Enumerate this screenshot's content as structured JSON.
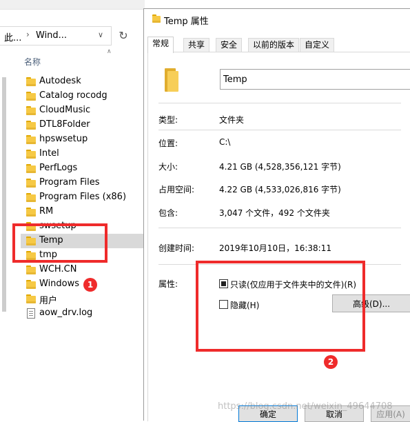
{
  "explorer": {
    "address_segments": [
      "此...",
      "Wind..."
    ],
    "column_header": "名称",
    "items": [
      {
        "name": "Autodesk",
        "type": "folder",
        "selected": false
      },
      {
        "name": "Catalog rocodg",
        "type": "folder",
        "selected": false
      },
      {
        "name": "CloudMusic",
        "type": "folder",
        "selected": false
      },
      {
        "name": "DTL8Folder",
        "type": "folder",
        "selected": false
      },
      {
        "name": "hpswsetup",
        "type": "folder",
        "selected": false
      },
      {
        "name": "Intel",
        "type": "folder",
        "selected": false
      },
      {
        "name": "PerfLogs",
        "type": "folder",
        "selected": false
      },
      {
        "name": "Program Files",
        "type": "folder",
        "selected": false
      },
      {
        "name": "Program Files (x86)",
        "type": "folder",
        "selected": false
      },
      {
        "name": "RM",
        "type": "folder",
        "selected": false
      },
      {
        "name": "swsetup",
        "type": "folder",
        "selected": false
      },
      {
        "name": "Temp",
        "type": "folder",
        "selected": true
      },
      {
        "name": "tmp",
        "type": "folder",
        "selected": false
      },
      {
        "name": "WCH.CN",
        "type": "folder",
        "selected": false
      },
      {
        "name": "Windows",
        "type": "folder",
        "selected": false
      },
      {
        "name": "用户",
        "type": "folder",
        "selected": false
      },
      {
        "name": "aow_drv.log",
        "type": "file",
        "selected": false
      }
    ]
  },
  "dialog": {
    "title": "Temp 属性",
    "tabs": [
      "常规",
      "共享",
      "安全",
      "以前的版本",
      "自定义"
    ],
    "active_tab": 0,
    "name_value": "Temp",
    "properties": {
      "type_label": "类型:",
      "type_value": "文件夹",
      "location_label": "位置:",
      "location_value": "C:\\",
      "size_label": "大小:",
      "size_value": "4.21 GB (4,528,356,121 字节)",
      "disk_label": "占用空间:",
      "disk_value": "4.22 GB (4,533,026,816 字节)",
      "contains_label": "包含:",
      "contains_value": "3,047 个文件，492 个文件夹",
      "created_label": "创建时间:",
      "created_value": "2019年10月10日，16:38:11",
      "attributes_label": "属性:"
    },
    "attributes": {
      "readonly_label": "只读(仅应用于文件夹中的文件)(R)",
      "readonly_state": "indeterminate",
      "hidden_label": "隐藏(H)",
      "hidden_checked": false,
      "advanced_label": "高级(D)..."
    },
    "buttons": {
      "ok": "确定",
      "cancel": "取消",
      "apply": "应用(A)"
    }
  },
  "annotations": {
    "badge_1": "1",
    "badge_2": "2",
    "color": "#ef2b2b"
  },
  "watermark": "https://blog.csdn.net/weixin_49644708"
}
